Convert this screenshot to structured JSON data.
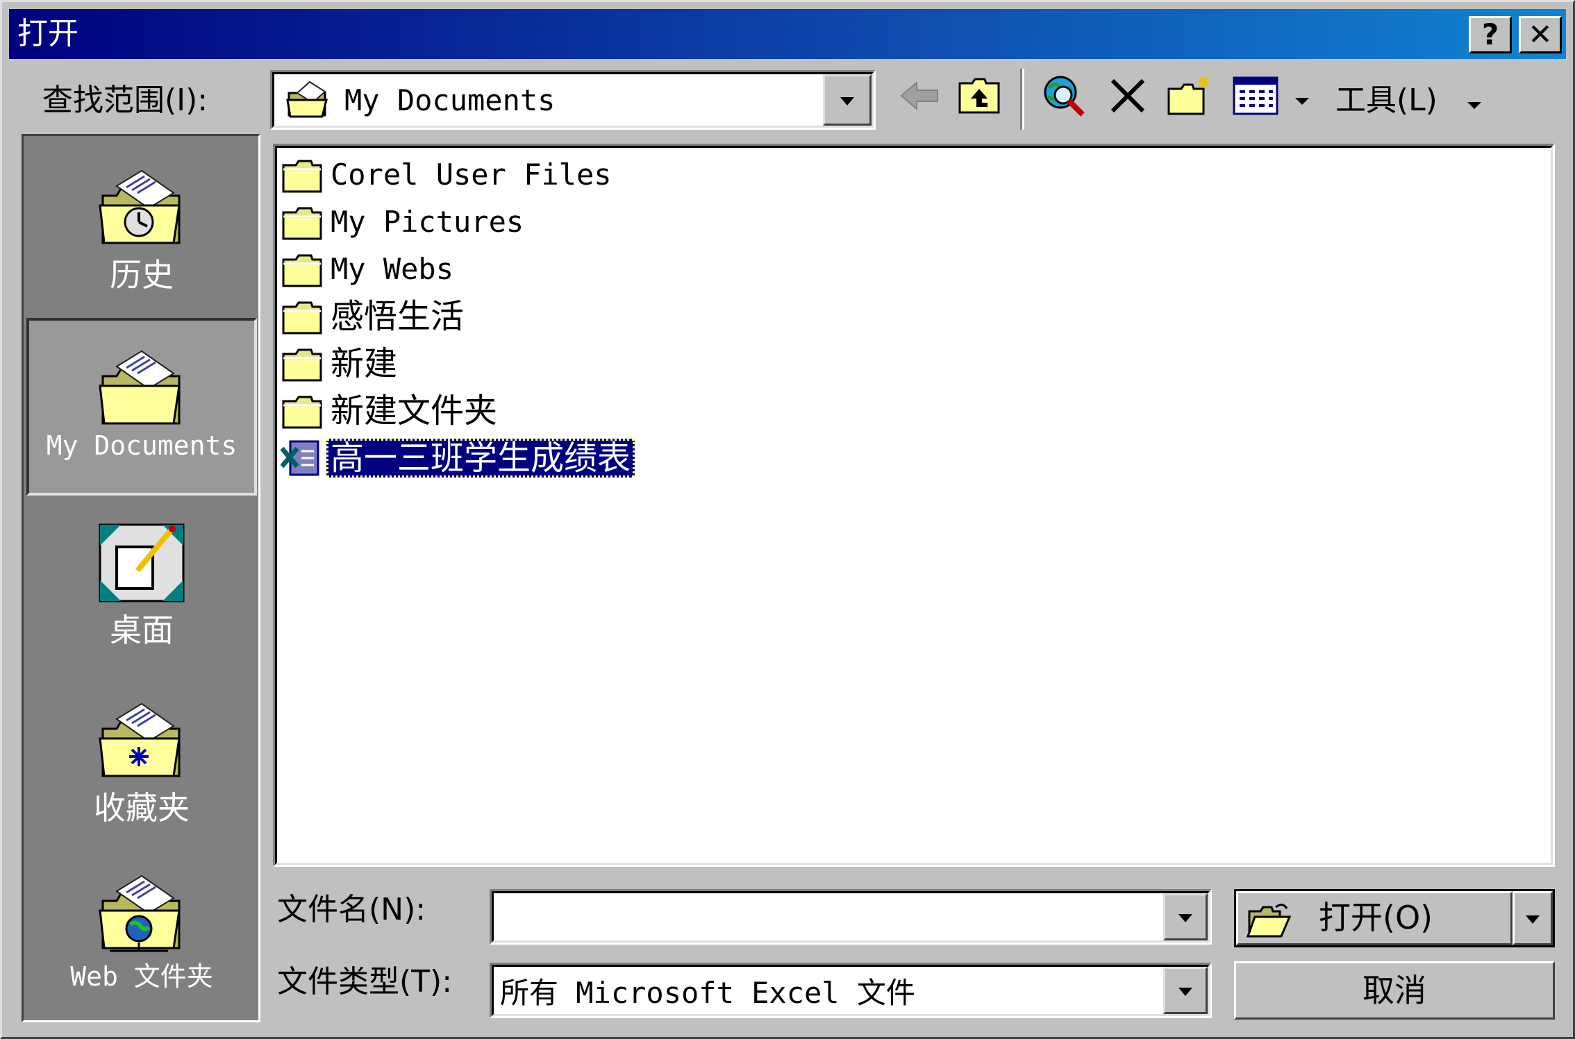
{
  "window": {
    "title": "打开",
    "help_label": "?",
    "close_label": "✕"
  },
  "lookin": {
    "label": "查找范围(I):",
    "value": "My Documents"
  },
  "toolbar": {
    "tools_label": "工具(L)"
  },
  "places": [
    {
      "label": "历史"
    },
    {
      "label": "My Documents"
    },
    {
      "label": "桌面"
    },
    {
      "label": "收藏夹"
    },
    {
      "label": "Web 文件夹"
    }
  ],
  "files": [
    {
      "name": "Corel User Files",
      "type": "folder"
    },
    {
      "name": "My Pictures",
      "type": "folder"
    },
    {
      "name": "My Webs",
      "type": "folder"
    },
    {
      "name": "感悟生活",
      "type": "folder"
    },
    {
      "name": "新建",
      "type": "folder"
    },
    {
      "name": "新建文件夹",
      "type": "folder"
    },
    {
      "name": "高一三班学生成绩表",
      "type": "excel",
      "selected": true
    }
  ],
  "filename": {
    "label": "文件名(N):",
    "value": ""
  },
  "filetype": {
    "label": "文件类型(T):",
    "value": "所有 Microsoft Excel 文件"
  },
  "buttons": {
    "open_label": "打开(O)",
    "cancel_label": "取消"
  },
  "colors": {
    "title_start": "#000080",
    "title_end": "#1084d0",
    "face": "#c0c0c0",
    "selection": "#000080"
  }
}
